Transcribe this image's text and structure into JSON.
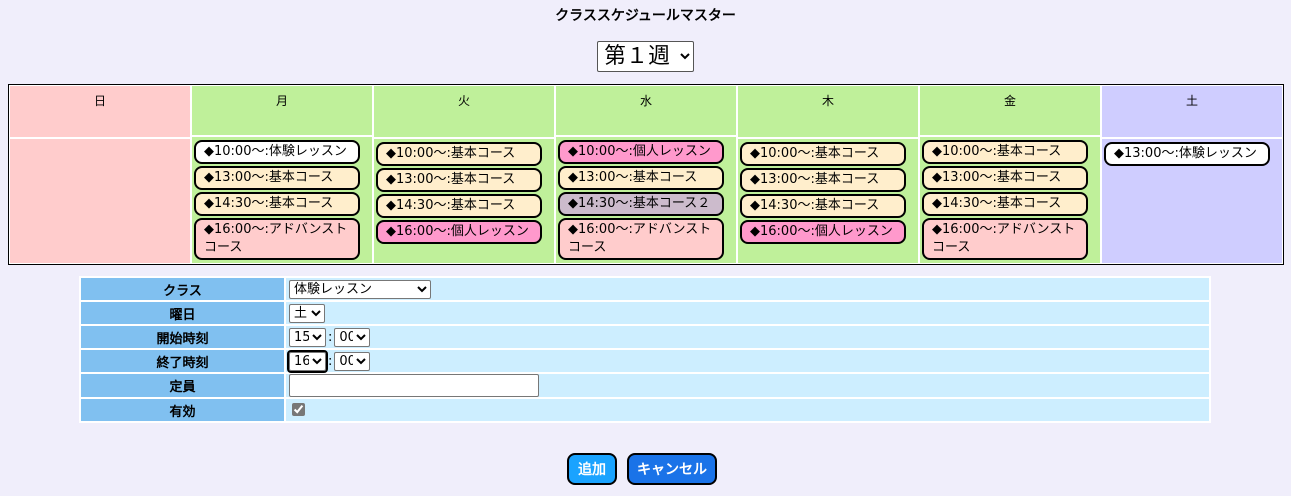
{
  "title": "クラススケジュールマスター",
  "week": {
    "selected": "第１週",
    "options": [
      "第１週"
    ]
  },
  "days": [
    {
      "name": "日",
      "cls": "sun",
      "slots": []
    },
    {
      "name": "月",
      "cls": "wk",
      "slots": [
        {
          "label": "◆10:00〜:体験レッスン",
          "kind": "trial"
        },
        {
          "label": "◆13:00〜:基本コース",
          "kind": "basic"
        },
        {
          "label": "◆14:30〜:基本コース",
          "kind": "basic"
        },
        {
          "label": "◆16:00〜:アドバンストコース",
          "kind": "advanced"
        }
      ]
    },
    {
      "name": "火",
      "cls": "wk",
      "slots": [
        {
          "label": "◆10:00〜:基本コース",
          "kind": "basic"
        },
        {
          "label": "◆13:00〜:基本コース",
          "kind": "basic"
        },
        {
          "label": "◆14:30〜:基本コース",
          "kind": "basic"
        },
        {
          "label": "◆16:00〜:個人レッスン",
          "kind": "private"
        }
      ]
    },
    {
      "name": "水",
      "cls": "wk",
      "slots": [
        {
          "label": "◆10:00〜:個人レッスン",
          "kind": "private"
        },
        {
          "label": "◆13:00〜:基本コース",
          "kind": "basic"
        },
        {
          "label": "◆14:30〜:基本コース２",
          "kind": "basic2"
        },
        {
          "label": "◆16:00〜:アドバンストコース",
          "kind": "advanced"
        }
      ]
    },
    {
      "name": "木",
      "cls": "wk",
      "slots": [
        {
          "label": "◆10:00〜:基本コース",
          "kind": "basic"
        },
        {
          "label": "◆13:00〜:基本コース",
          "kind": "basic"
        },
        {
          "label": "◆14:30〜:基本コース",
          "kind": "basic"
        },
        {
          "label": "◆16:00〜:個人レッスン",
          "kind": "private"
        }
      ]
    },
    {
      "name": "金",
      "cls": "wk",
      "slots": [
        {
          "label": "◆10:00〜:基本コース",
          "kind": "basic"
        },
        {
          "label": "◆13:00〜:基本コース",
          "kind": "basic"
        },
        {
          "label": "◆14:30〜:基本コース",
          "kind": "basic"
        },
        {
          "label": "◆16:00〜:アドバンストコース",
          "kind": "advanced"
        }
      ]
    },
    {
      "name": "土",
      "cls": "sat",
      "slots": [
        {
          "label": "◆13:00〜:体験レッスン",
          "kind": "trial"
        }
      ]
    }
  ],
  "form": {
    "class_label": "クラス",
    "class_value": "体験レッスン",
    "day_label": "曜日",
    "day_value": "土",
    "start_label": "開始時刻",
    "start_hour": "15",
    "start_min": "00",
    "end_label": "終了時刻",
    "end_hour": "16",
    "end_min": "00",
    "colon": ":",
    "capacity_label": "定員",
    "capacity_value": "",
    "active_label": "有効",
    "active_checked": true
  },
  "buttons": {
    "add": "追加",
    "cancel": "キャンセル"
  },
  "colors": {
    "accent": "#1a73e8",
    "header_cell": "#80c0f0",
    "form_cell": "#cdeeff"
  }
}
